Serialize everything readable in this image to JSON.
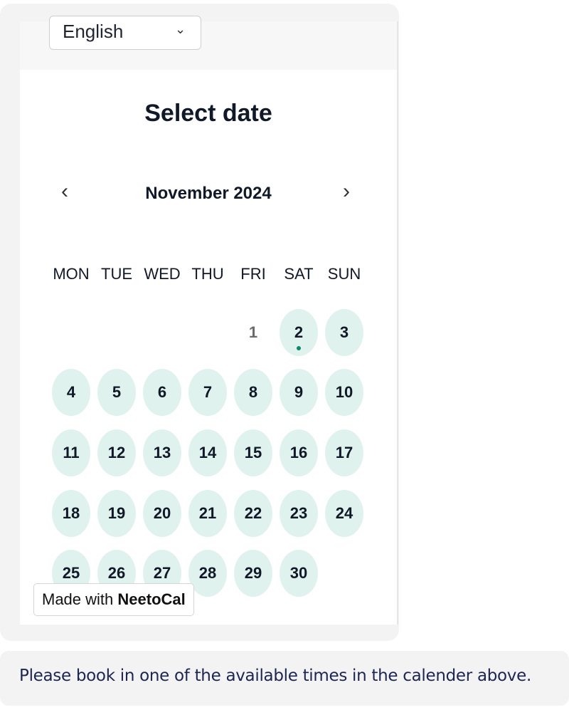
{
  "language_select": {
    "value": "English"
  },
  "heading": "Select date",
  "calendar": {
    "month_label": "November 2024",
    "prev_icon": "chevron-left-icon",
    "next_icon": "chevron-right-icon",
    "weekdays": [
      "MON",
      "TUE",
      "WED",
      "THU",
      "FRI",
      "SAT",
      "SUN"
    ],
    "first_weekday_index": 4,
    "days": [
      {
        "d": "1",
        "available": false
      },
      {
        "d": "2",
        "available": true,
        "today_dot": true
      },
      {
        "d": "3",
        "available": true
      },
      {
        "d": "4",
        "available": true
      },
      {
        "d": "5",
        "available": true
      },
      {
        "d": "6",
        "available": true
      },
      {
        "d": "7",
        "available": true
      },
      {
        "d": "8",
        "available": true
      },
      {
        "d": "9",
        "available": true
      },
      {
        "d": "10",
        "available": true
      },
      {
        "d": "11",
        "available": true
      },
      {
        "d": "12",
        "available": true
      },
      {
        "d": "13",
        "available": true
      },
      {
        "d": "14",
        "available": true
      },
      {
        "d": "15",
        "available": true
      },
      {
        "d": "16",
        "available": true
      },
      {
        "d": "17",
        "available": true
      },
      {
        "d": "18",
        "available": true
      },
      {
        "d": "19",
        "available": true
      },
      {
        "d": "20",
        "available": true
      },
      {
        "d": "21",
        "available": true
      },
      {
        "d": "22",
        "available": true
      },
      {
        "d": "23",
        "available": true
      },
      {
        "d": "24",
        "available": true
      },
      {
        "d": "25",
        "available": true
      },
      {
        "d": "26",
        "available": true
      },
      {
        "d": "27",
        "available": true
      },
      {
        "d": "28",
        "available": true
      },
      {
        "d": "29",
        "available": true
      },
      {
        "d": "30",
        "available": true
      }
    ],
    "available_color": "#dff2ee",
    "dot_color": "#0d8a6a"
  },
  "branding": {
    "prefix": "Made with ",
    "brand": "NeetoCal"
  },
  "note": "Please book in one of the available times in the calender above."
}
